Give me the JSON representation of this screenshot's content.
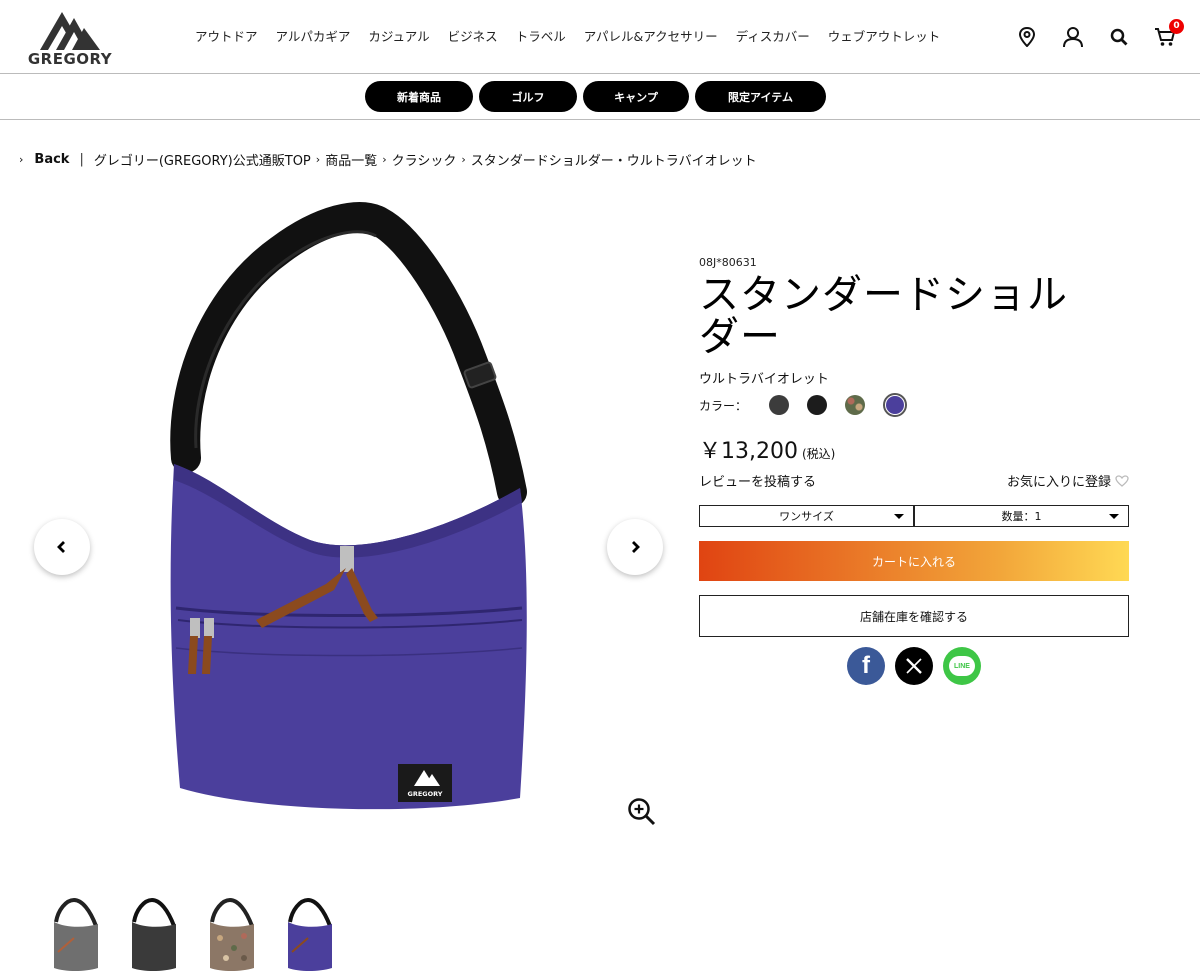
{
  "header": {
    "logo_text": "GREGORY",
    "nav": [
      "アウトドア",
      "アルパカギア",
      "カジュアル",
      "ビジネス",
      "トラベル",
      "アパレル&アクセサリー",
      "ディスカバー",
      "ウェブアウトレット"
    ],
    "cart_count": "0"
  },
  "subnav": {
    "pills": [
      "新着商品",
      "ゴルフ",
      "キャンプ",
      "限定アイテム"
    ]
  },
  "breadcrumb": {
    "back": "Back",
    "items": [
      "グレゴリー(GREGORY)公式通販TOP",
      "商品一覧",
      "クラシック",
      "スタンダードショルダー・ウルトラバイオレット"
    ]
  },
  "gallery": {
    "logo_label": "GREGORY"
  },
  "product": {
    "sku": "08J*80631",
    "name_line1": "スタンダードショル",
    "name_line2": "ダー",
    "color_name": "ウルトラバイオレット",
    "color_label": "カラー：",
    "swatches": [
      "#3c3c3c",
      "#1c1c1c",
      "#6b6f4a",
      "#4b3f9c"
    ],
    "price": "￥13,200",
    "price_tax": "(税込)",
    "review_link": "レビューを投稿する",
    "favorite": "お気に入りに登録",
    "size_select": "ワンサイズ",
    "qty_select": "数量：1",
    "cart_button": "カートに入れる",
    "store_button": "店舗在庫を確認する",
    "social": {
      "facebook": "f",
      "line": "LINE"
    }
  },
  "colors": {
    "accent_start": "#e04412",
    "accent_end": "#ffd954",
    "bag_purple": "#4b3f9c",
    "facebook": "#3b5998",
    "line": "#3ec646"
  }
}
